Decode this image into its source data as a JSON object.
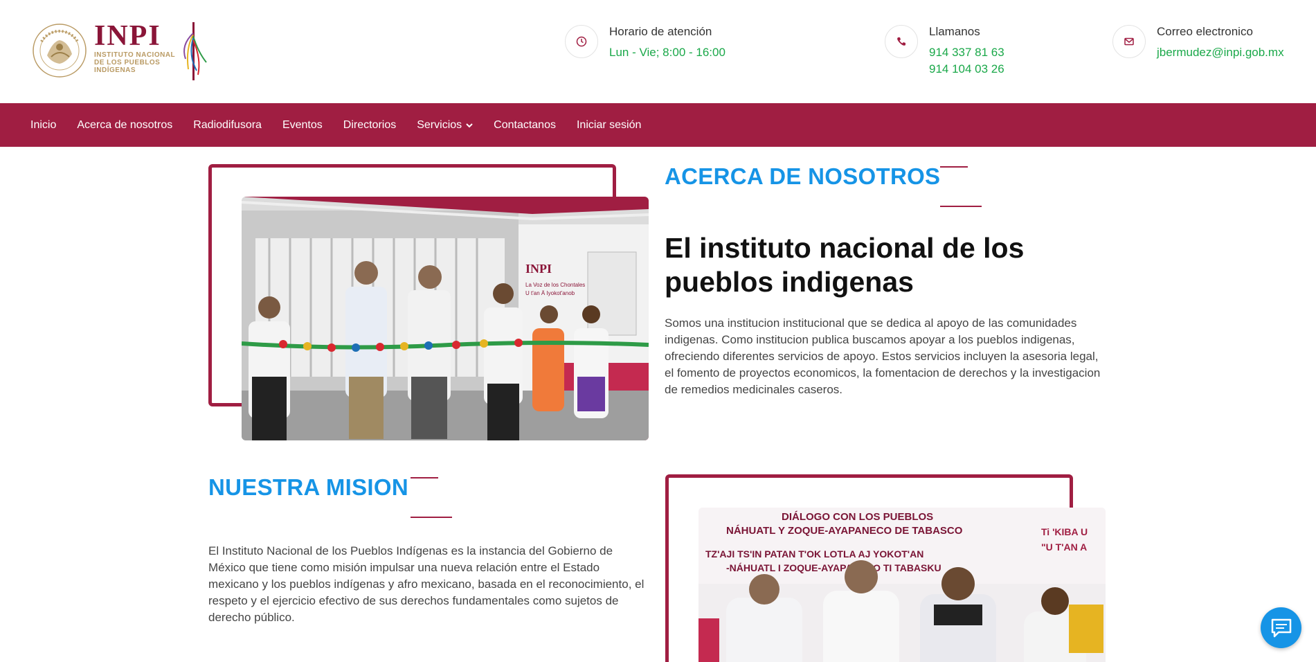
{
  "brand": {
    "logo_text": "INPI",
    "logo_subtitle_1": "INSTITUTO NACIONAL",
    "logo_subtitle_2": "DE LOS PUEBLOS",
    "logo_subtitle_3": "INDÍGENAS",
    "seal_text": "ESTADOS UNIDOS MEXICANOS",
    "color_primary": "#a01e42",
    "color_accent": "#1694e6",
    "color_green": "#1aa849"
  },
  "contact": {
    "hours": {
      "icon": "clock-icon",
      "label": "Horario de atención",
      "value": "Lun - Vie; 8:00 - 16:00"
    },
    "phone": {
      "icon": "phone-icon",
      "label": "Llamanos",
      "value_1": "914 337 81 63",
      "value_2": "914 104 03 26"
    },
    "email": {
      "icon": "envelope-icon",
      "label": "Correo electronico",
      "value": "jbermudez@inpi.gob.mx"
    }
  },
  "nav": {
    "items": [
      {
        "label": "Inicio"
      },
      {
        "label": "Acerca de nosotros"
      },
      {
        "label": "Radiodifusora"
      },
      {
        "label": "Eventos"
      },
      {
        "label": "Directorios"
      },
      {
        "label": "Servicios",
        "has_dropdown": true
      },
      {
        "label": "Contactanos"
      },
      {
        "label": "Iniciar sesión"
      }
    ]
  },
  "about": {
    "section_title": "ACERCA DE NOSOTROS",
    "heading": "El instituto nacional de los pueblos indigenas",
    "body": "Somos una institucion institucional que se dedica al apoyo de las comunidades indigenas. Como institucion publica buscamos apoyar a los pueblos indigenas, ofreciendo diferentes servicios de apoyo. Estos servicios incluyen la asesoria legal, el fomento de proyectos economicos, la fomentacion de derechos y la investigacion de remedios medicinales caseros.",
    "image_sign_1": "INPI",
    "image_sign_2": "La Voz de los Chontales",
    "image_sign_3": "U t'an Ä Iyokot'anob"
  },
  "mission": {
    "section_title": "NUESTRA MISION",
    "body": "El Instituto Nacional de los Pueblos Indígenas es la instancia del Gobierno de México que tiene como misión impulsar una nueva relación entre el Estado mexicano y los pueblos indígenas y afro mexicano, basada en el reconocimiento, el respeto y el ejercicio efectivo de sus derechos fundamentales como sujetos de derecho público.",
    "banner_1": "DIÁLOGO CON LOS PUEBLOS",
    "banner_2": "NÁHUATL Y ZOQUE-AYAPANECO DE TABASCO",
    "banner_3": "TZ'AJI TS'IN PATAN T'OK LOTLA AJ YOKOT'AN",
    "banner_4": "-NÁHUATL I ZOQUE-AYAPANEKO TI TABASKU",
    "banner_right_1": "Ti 'KIBA U",
    "banner_right_2": "\"U T'AN A"
  },
  "chat": {
    "icon": "chat-icon"
  }
}
